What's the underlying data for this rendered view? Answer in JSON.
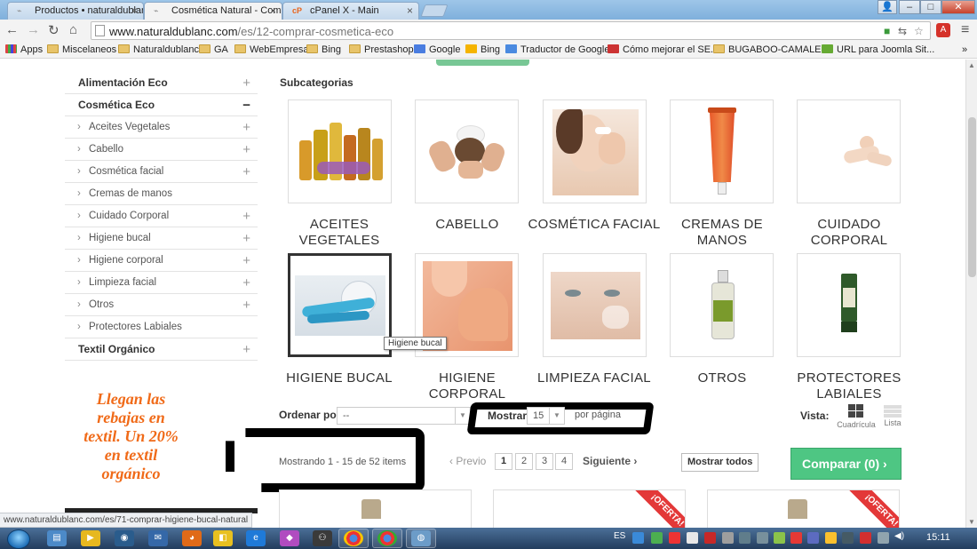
{
  "browser": {
    "tabs": [
      {
        "label": "Productos • naturaldublar",
        "active": false
      },
      {
        "label": "Cosmética Natural - Comp",
        "active": true
      },
      {
        "label": "cPanel X - Main",
        "active": false
      }
    ],
    "url_host": "www.naturaldublanc.com",
    "url_path": "/es/12-comprar-cosmetica-eco",
    "bookmarks": [
      "Apps",
      "Miscelaneos",
      "Naturaldublanc",
      "GA",
      "WebEmpresa",
      "Bing",
      "Prestashop",
      "Google",
      "Bing",
      "Traductor de Google",
      "Cómo mejorar el SE...",
      "BUGABOO-CAMALE...",
      "URL para Joomla Sit..."
    ],
    "bookmarks_more": "»"
  },
  "sidebar": {
    "categories": [
      {
        "label": "Alimentación Eco",
        "level": "top",
        "toggle": "+"
      },
      {
        "label": "Cosmética Eco",
        "level": "top",
        "toggle": "−"
      },
      {
        "label": "Aceites Vegetales",
        "level": "sub",
        "toggle": "+"
      },
      {
        "label": "Cabello",
        "level": "sub",
        "toggle": "+"
      },
      {
        "label": "Cosmética facial",
        "level": "sub",
        "toggle": "+"
      },
      {
        "label": "Cremas de manos",
        "level": "sub",
        "toggle": ""
      },
      {
        "label": "Cuidado Corporal",
        "level": "sub",
        "toggle": "+"
      },
      {
        "label": "Higiene bucal",
        "level": "sub",
        "toggle": "+"
      },
      {
        "label": "Higiene corporal",
        "level": "sub",
        "toggle": "+"
      },
      {
        "label": "Limpieza facial",
        "level": "sub",
        "toggle": "+"
      },
      {
        "label": "Otros",
        "level": "sub",
        "toggle": "+"
      },
      {
        "label": "Protectores Labiales",
        "level": "sub",
        "toggle": ""
      },
      {
        "label": "Textil Orgánico",
        "level": "top",
        "toggle": "+"
      }
    ],
    "promo": "Llegan las rebajas en textil. Un 20% en textil orgánico"
  },
  "subcategories": {
    "title": "Subcategorias",
    "items": [
      {
        "label": "ACEITES VEGETALES",
        "icon": "oil-bottles-image"
      },
      {
        "label": "CABELLO",
        "icon": "hair-wash-image"
      },
      {
        "label": "COSMÉTICA FACIAL",
        "icon": "face-cream-image"
      },
      {
        "label": "CREMAS DE MANOS",
        "icon": "cream-tube-image"
      },
      {
        "label": "CUIDADO CORPORAL",
        "icon": "body-care-image"
      },
      {
        "label": "HIGIENE BUCAL",
        "icon": "toothpaste-image"
      },
      {
        "label": "HIGIENE CORPORAL",
        "icon": "shoulder-skin-image"
      },
      {
        "label": "LIMPIEZA FACIAL",
        "icon": "face-mask-image"
      },
      {
        "label": "OTROS",
        "icon": "spray-bottle-image"
      },
      {
        "label": "PROTECTORES LABIALES",
        "icon": "lip-balm-image"
      }
    ],
    "tooltip": "Higiene bucal"
  },
  "sorting": {
    "label": "Ordenar por",
    "value": "--",
    "show_label": "Mostrar",
    "per_page": "15",
    "per_page_suffix": "por página",
    "view_label": "Vista:",
    "view_grid": "Cuadrícula",
    "view_list": "Lista"
  },
  "paging": {
    "showing": "Mostrando 1 - 15 de 52 items",
    "prev": "Previo",
    "pages": [
      "1",
      "2",
      "3",
      "4"
    ],
    "current": "1",
    "next": "Siguiente",
    "show_all": "Mostrar todos",
    "compare": "Comparar (0)"
  },
  "products": {
    "ribbon": "¡OFERTA!"
  },
  "statusbar": "www.naturaldublanc.com/es/71-comprar-higiene-bucal-natural",
  "taskbar": {
    "lang": "ES",
    "time": "15:11"
  },
  "colors": {
    "accent_green": "#4ec683",
    "promo_orange": "#f06a18",
    "ribbon_red": "#e33838"
  }
}
